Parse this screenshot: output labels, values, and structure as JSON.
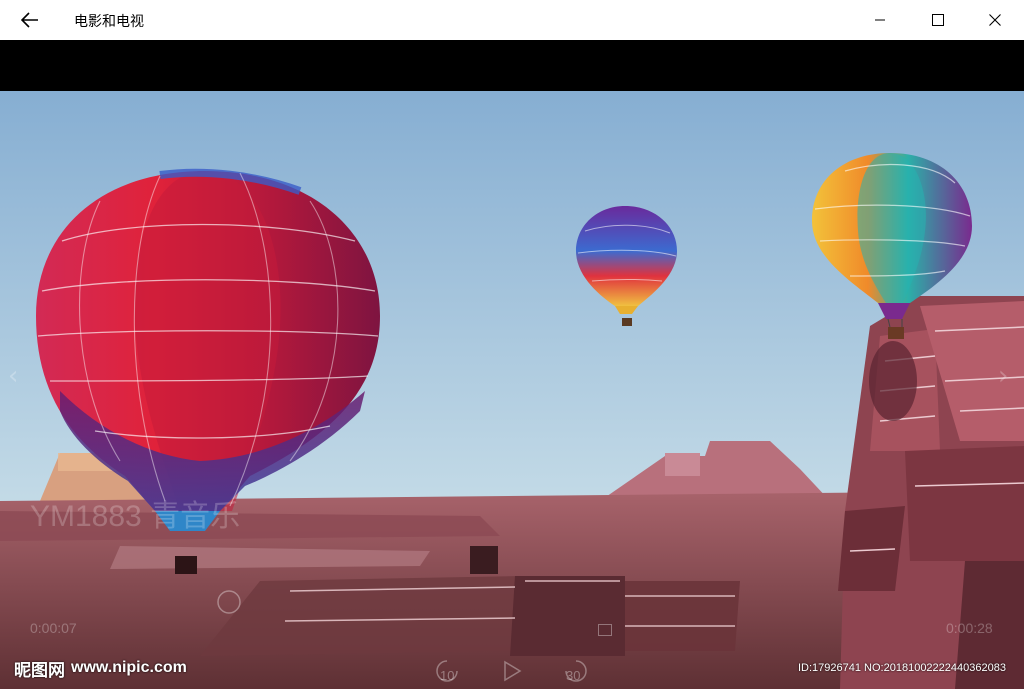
{
  "window": {
    "title": "电影和电视",
    "back_icon": "arrow-left-icon",
    "minimize_icon": "minimize-icon",
    "maximize_icon": "maximize-icon",
    "close_icon": "close-icon"
  },
  "player": {
    "elapsed": "0:00:07",
    "remaining": "0:00:28",
    "skip_back_label": "10",
    "skip_forward_label": "30",
    "play_icon": "play-icon",
    "prev_arrow": "‹",
    "next_arrow": "›"
  },
  "watermarks": {
    "video_overlay": "YM1883 青音乐",
    "site_name": "昵图网",
    "site_url": "www.nipic.com",
    "id_line": "ID:17926741 NO:20181002222440362083"
  },
  "colors": {
    "sky_top": "#8fb6d6",
    "sky_bottom": "#c5dce8",
    "desert": "#9a5a63",
    "titlebar": "#ffffff"
  }
}
